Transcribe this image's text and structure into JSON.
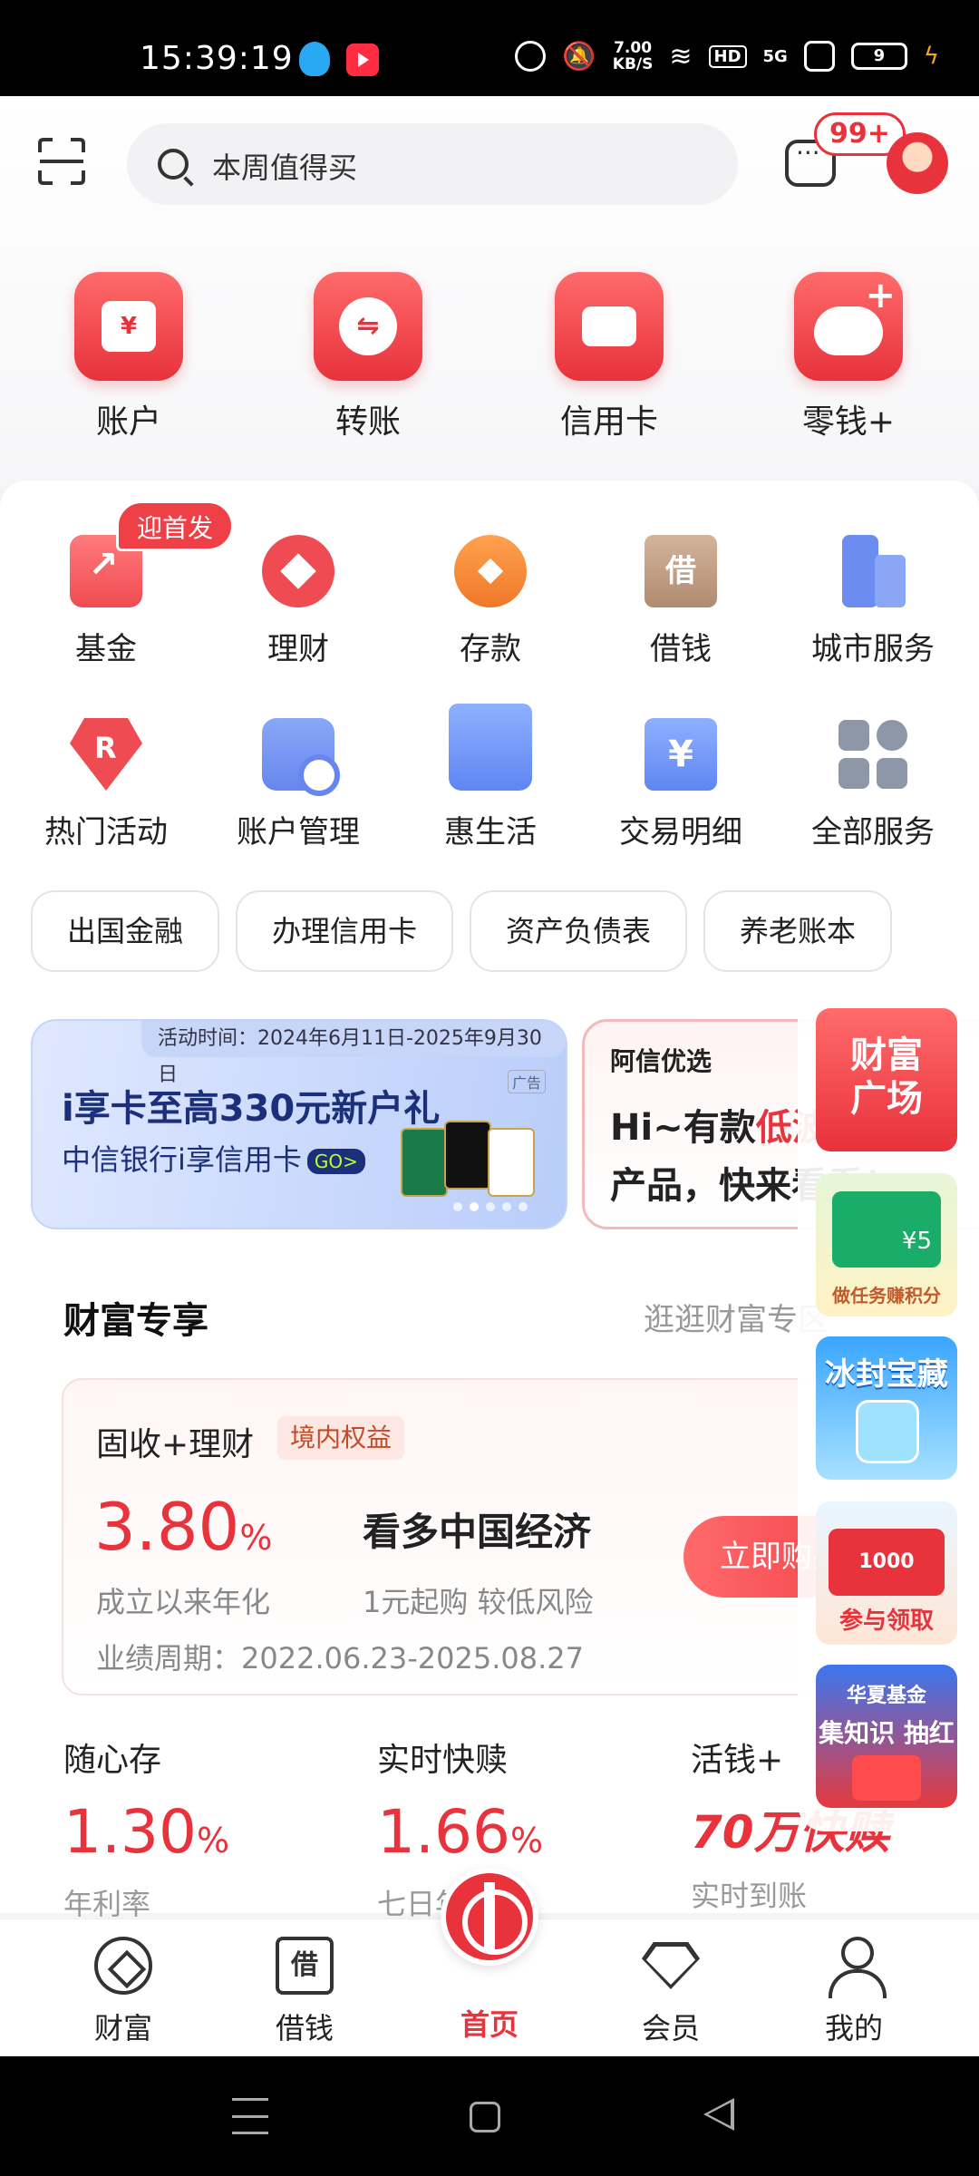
{
  "status_bar": {
    "time": "15:39:19",
    "net_speed": "7.00\nKB/S",
    "hd": "HD",
    "signal": "5G",
    "battery": "9"
  },
  "header": {
    "search_placeholder": "本周值得买",
    "message_badge": "99+"
  },
  "top_nav": [
    {
      "label": "账户",
      "icon": "wallet-icon",
      "glyph": "¥"
    },
    {
      "label": "转账",
      "icon": "transfer-icon",
      "glyph": "⇋"
    },
    {
      "label": "信用卡",
      "icon": "credit-card-icon",
      "glyph": ""
    },
    {
      "label": "零钱+",
      "icon": "piggy-bank-icon",
      "glyph": "+"
    }
  ],
  "services": {
    "promo_tag": "迎首发",
    "row1": [
      {
        "label": "基金",
        "icon": "fund-icon"
      },
      {
        "label": "理财",
        "icon": "wealth-management-icon"
      },
      {
        "label": "存款",
        "icon": "deposit-icon"
      },
      {
        "label": "借钱",
        "icon": "loan-icon",
        "glyph": "借"
      },
      {
        "label": "城市服务",
        "icon": "city-service-icon"
      }
    ],
    "row2": [
      {
        "label": "热门活动",
        "icon": "hot-activity-icon"
      },
      {
        "label": "账户管理",
        "icon": "account-management-icon"
      },
      {
        "label": "惠生活",
        "icon": "life-store-icon"
      },
      {
        "label": "交易明细",
        "icon": "transaction-detail-icon",
        "glyph": "¥"
      },
      {
        "label": "全部服务",
        "icon": "all-services-icon"
      }
    ]
  },
  "chips": [
    "出国金融",
    "办理信用卡",
    "资产负债表",
    "养老账本"
  ],
  "banners": [
    {
      "period": "活动时间：2024年6月11日-2025年9月30日",
      "ad": "广告",
      "title": "i享卡至高330元新户礼",
      "subtitle": "中信银行i享信用卡",
      "go": "GO>"
    },
    {
      "header": "阿信优选",
      "line1_a": "Hi~有款",
      "line1_b": "低波",
      "line2": "产品，快来看看！"
    }
  ],
  "floating_rail": [
    {
      "text": "财富\n广场"
    },
    {
      "card_value": "¥5",
      "text": "做任务赚积分"
    },
    {
      "text": "冰封宝藏"
    },
    {
      "card_text": "1000",
      "text": "参与领取"
    },
    {
      "text": "华夏基金",
      "text2": "集知识 抽红包"
    }
  ],
  "wealth": {
    "title": "财富专享",
    "more": "逛逛财富专区",
    "product": {
      "name": "固收+理财",
      "tag": "境内权益",
      "rate": "3.80",
      "rate_unit": "%",
      "rate_desc": "成立以来年化",
      "headline": "看多中国经济",
      "headline_sub": "1元起购 较低风险",
      "period": "业绩周期：2022.06.23-2025.08.27",
      "buy": "立即购买"
    },
    "minis": [
      {
        "title": "随心存",
        "value": "1.30",
        "unit": "%",
        "desc": "年利率"
      },
      {
        "title": "实时快赎",
        "value": "1.66",
        "unit": "%",
        "desc": "七日年化"
      },
      {
        "title": "活钱+",
        "big": "70万快赎",
        "desc": "实时到账"
      }
    ]
  },
  "bottom_nav": [
    {
      "label": "财富",
      "icon": "wealth-tab-icon"
    },
    {
      "label": "借钱",
      "icon": "loan-tab-icon",
      "glyph": "借"
    },
    {
      "label": "首页",
      "icon": "home-logo-icon",
      "active": true
    },
    {
      "label": "会员",
      "icon": "member-tab-icon"
    },
    {
      "label": "我的",
      "icon": "profile-tab-icon"
    }
  ],
  "colors": {
    "accent": "#e8323c",
    "text": "#222222",
    "muted": "#888888"
  }
}
